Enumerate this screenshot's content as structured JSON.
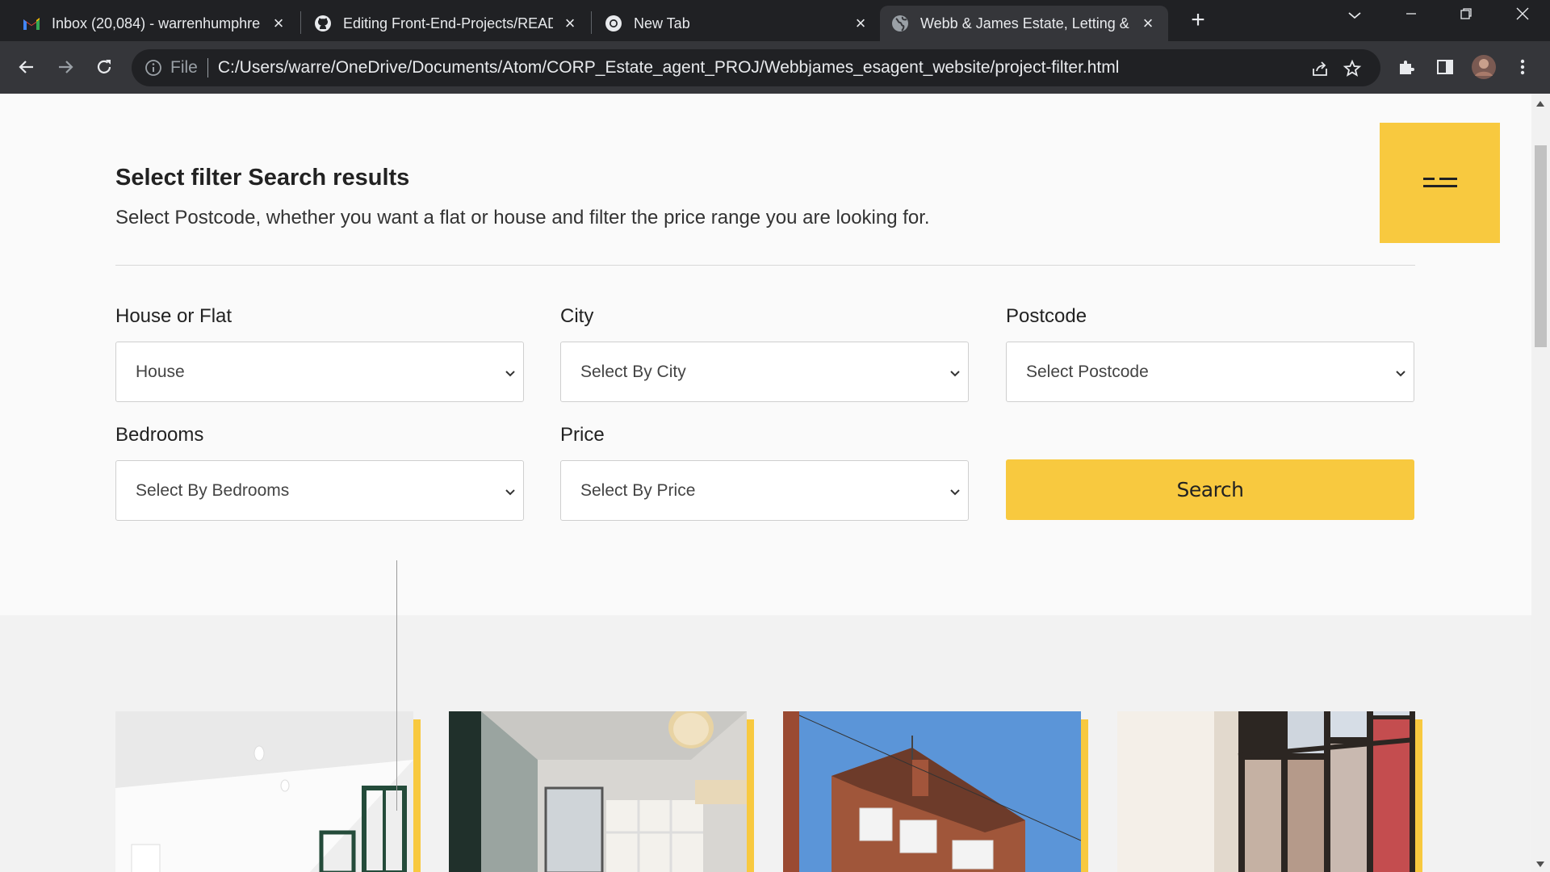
{
  "browser": {
    "tabs": [
      {
        "title": "Inbox (20,084) - warrenhumphre",
        "icon": "gmail-icon"
      },
      {
        "title": "Editing Front-End-Projects/READ",
        "icon": "github-icon"
      },
      {
        "title": "New Tab",
        "icon": "chrome-icon"
      },
      {
        "title": "Webb & James Estate, Letting &",
        "icon": "globe-icon",
        "active": true
      }
    ],
    "address": {
      "scheme_label": "File",
      "url": "C:/Users/warre/OneDrive/Documents/Atom/CORP_Estate_agent_PROJ/Webbjames_esagent_website/project-filter.html"
    }
  },
  "page": {
    "heading": "Select filter Search results",
    "subheading": "Select Postcode, whether you want a flat or house and filter the price range you are looking for.",
    "accent_color": "#f8c93f",
    "filters": {
      "type": {
        "label": "House or Flat",
        "value": "House"
      },
      "city": {
        "label": "City",
        "value": "Select By City"
      },
      "postcode": {
        "label": "Postcode",
        "value": "Select Postcode"
      },
      "bedrooms": {
        "label": "Bedrooms",
        "value": "Select By Bedrooms"
      },
      "price": {
        "label": "Price",
        "value": "Select By Price"
      }
    },
    "search_button": "Search"
  }
}
